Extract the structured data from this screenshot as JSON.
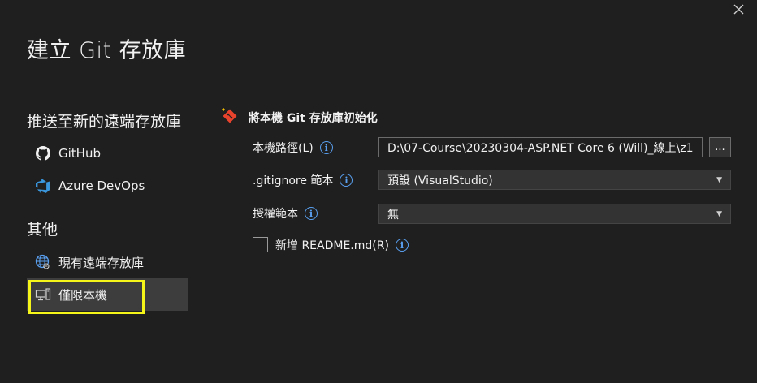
{
  "window": {
    "title": "建立 Git 存放庫",
    "close_icon": "close-icon"
  },
  "sidebar": {
    "push_heading": "推送至新的遠端存放庫",
    "push_items": [
      {
        "label": "GitHub",
        "icon": "github-icon"
      },
      {
        "label": "Azure DevOps",
        "icon": "azure-devops-icon"
      }
    ],
    "other_heading": "其他",
    "other_items": [
      {
        "label": "現有遠端存放庫",
        "icon": "globe-icon"
      },
      {
        "label": "僅限本機",
        "icon": "local-machine-icon",
        "selected": true
      }
    ]
  },
  "panel": {
    "header": "將本機 Git 存放庫初始化",
    "header_icon": "git-icon",
    "local_path_label": "本機路徑(L)",
    "local_path_value": "D:\\07-Course\\20230304-ASP.NET Core 6 (Will)_線上\\z1",
    "browse_label": "...",
    "gitignore_label": ".gitignore 範本",
    "gitignore_value": "預設 (VisualStudio)",
    "license_label": "授權範本",
    "license_value": "無",
    "readme_label": "新增 README.md(R)",
    "readme_checked": false
  },
  "colors": {
    "background": "#1f1f1f",
    "selected_item": "#3d3d3d",
    "highlight_border": "#f5f51a",
    "info_blue": "#5aa0f0",
    "git_red": "#e8432c"
  }
}
